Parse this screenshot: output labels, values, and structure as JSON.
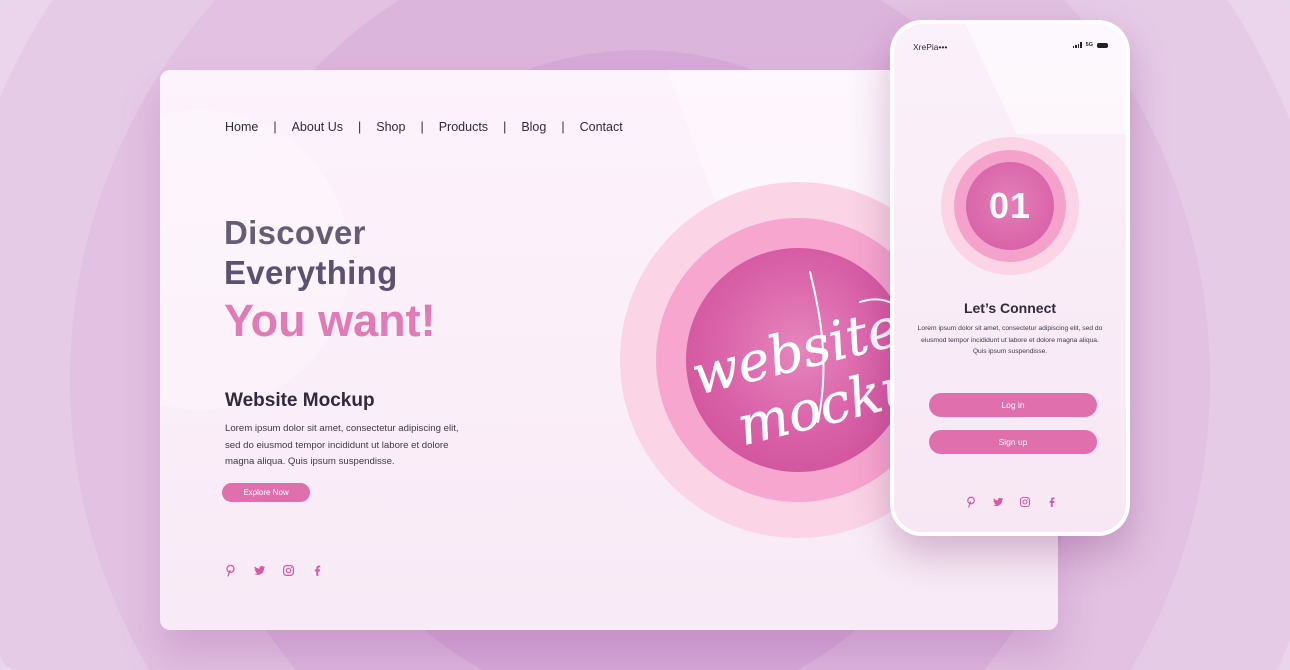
{
  "colors": {
    "accent_pink": "#df70ad",
    "heading_gray": "#655d74",
    "headline_pink": "#e07bb5",
    "dark_text": "#2f2a3d",
    "circle_outer": "#fbd4e6",
    "circle_middle": "#f7a6cf",
    "circle_inner": "#d85ea6"
  },
  "desktop": {
    "nav": {
      "items": [
        "Home",
        "About Us",
        "Shop",
        "Products",
        "Blog",
        "Contact"
      ],
      "separator": "|"
    },
    "hero": {
      "line1": "Discover",
      "line2": "Everything",
      "line3": "You want!"
    },
    "section_title": "Website Mockup",
    "body_text": "Lorem ipsum dolor sit amet, consectetur adipiscing elit, sed do eiusmod tempor incididunt ut labore et dolore magna aliqua. Quis ipsum suspendisse.",
    "cta_label": "Explore Now",
    "script_art_text": "website mockup",
    "social_icons": [
      "pinterest-icon",
      "twitter-icon",
      "instagram-icon",
      "facebook-icon"
    ]
  },
  "phone": {
    "carrier": "XrePia•••",
    "network": "5G",
    "badge_number": "01",
    "title": "Let’s Connect",
    "body_text": "Lorem ipsum dolor sit amet, consectetur adipiscing elit, sed do eiusmod tempor incididunt ut labore et dolore magna aliqua. Quis ipsum suspendisse.",
    "login_label": "Log in",
    "signup_label": "Sign up",
    "social_icons": [
      "pinterest-icon",
      "twitter-icon",
      "instagram-icon",
      "facebook-icon"
    ]
  }
}
